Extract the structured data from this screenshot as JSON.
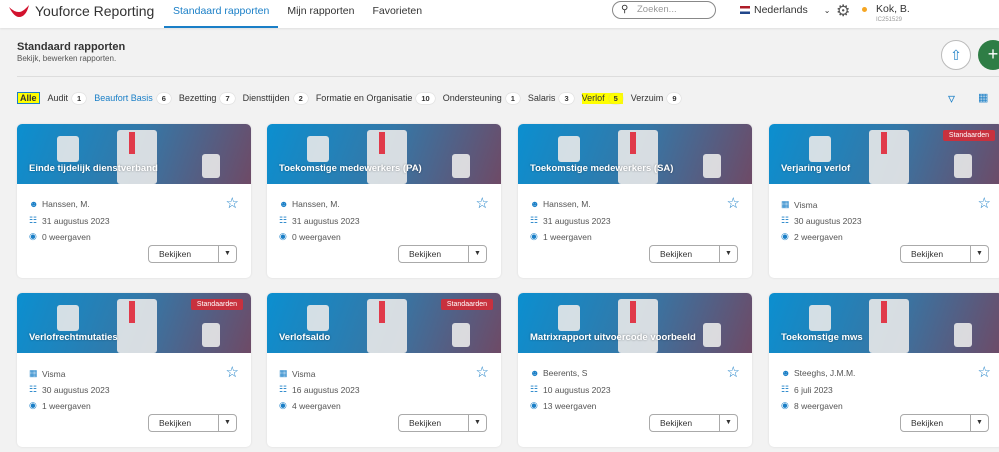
{
  "app": {
    "title": "Youforce Reporting",
    "brand_color": "#d2122e"
  },
  "nav": [
    {
      "label": "Standaard rapporten",
      "active": true
    },
    {
      "label": "Mijn rapporten"
    },
    {
      "label": "Favorieten"
    }
  ],
  "search": {
    "placeholder": "Zoeken..."
  },
  "language": "Nederlands",
  "user": {
    "name": "Kok, B.",
    "id": "IC251529"
  },
  "page": {
    "title": "Standaard rapporten",
    "subtitle": "Bekijk, bewerken rapporten."
  },
  "filters": [
    {
      "label": "Alle",
      "active": true
    },
    {
      "label": "Audit",
      "count": "1"
    },
    {
      "label": "Beaufort Basis",
      "count": "6",
      "link": true
    },
    {
      "label": "Bezetting",
      "count": "7"
    },
    {
      "label": "Diensttijden",
      "count": "2"
    },
    {
      "label": "Formatie en Organisatie",
      "count": "10"
    },
    {
      "label": "Ondersteuning",
      "count": "1"
    },
    {
      "label": "Salaris",
      "count": "3"
    },
    {
      "label": "Verlof",
      "count": "5",
      "highlight": true
    },
    {
      "label": "Verzuim",
      "count": "9"
    }
  ],
  "view_button": "Bekijken",
  "cards": [
    {
      "title": "Einde tijdelijk dienstverband",
      "owner": "Hanssen, M.",
      "owner_icon": "user-icon",
      "date": "31 augustus 2023",
      "views": "0 weergaven"
    },
    {
      "title": "Toekomstige medewerkers (PA)",
      "owner": "Hanssen, M.",
      "owner_icon": "user-icon",
      "date": "31 augustus 2023",
      "views": "0 weergaven"
    },
    {
      "title": "Toekomstige medewerkers (SA)",
      "owner": "Hanssen, M.",
      "owner_icon": "user-icon",
      "date": "31 augustus 2023",
      "views": "1 weergaven"
    },
    {
      "title": "Verjaring verlof",
      "badge": "Standaarden",
      "owner": "Visma",
      "owner_icon": "building-icon",
      "date": "30 augustus 2023",
      "views": "2 weergaven"
    },
    {
      "title": "Verlofrechtmutaties",
      "badge": "Standaarden",
      "owner": "Visma",
      "owner_icon": "building-icon",
      "date": "30 augustus 2023",
      "views": "1 weergaven"
    },
    {
      "title": "Verlofsaldo",
      "badge": "Standaarden",
      "owner": "Visma",
      "owner_icon": "building-icon",
      "date": "16 augustus 2023",
      "views": "4 weergaven"
    },
    {
      "title": "Matrixrapport uitvoercode voorbeeld",
      "owner": "Beerents, S",
      "owner_icon": "user-icon",
      "date": "10 augustus 2023",
      "views": "13 weergaven"
    },
    {
      "title": "Toekomstige mws",
      "owner": "Steeghs, J.M.M.",
      "owner_icon": "user-icon",
      "date": "6 juli 2023",
      "views": "8 weergaven"
    }
  ]
}
